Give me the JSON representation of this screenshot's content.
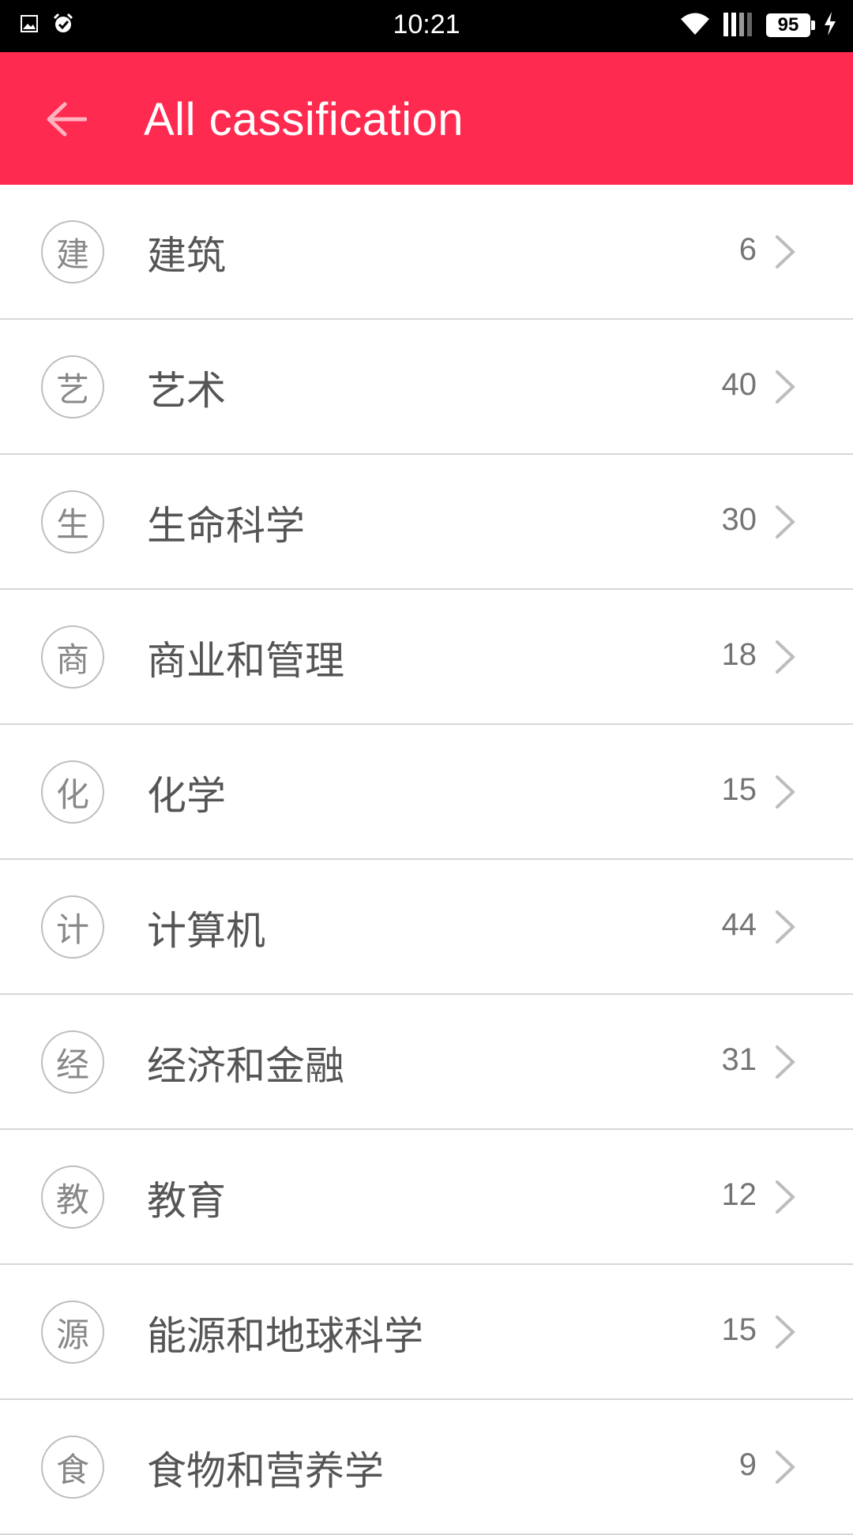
{
  "status_bar": {
    "time": "10:21",
    "battery": "95",
    "icons": [
      "image-icon",
      "alarm-icon",
      "wifi-icon",
      "signal-icon",
      "battery-icon",
      "charging-icon"
    ]
  },
  "app_bar": {
    "title": "All cassification",
    "background": "#ff2a50"
  },
  "categories": [
    {
      "badge": "建",
      "label": "建筑",
      "count": "6"
    },
    {
      "badge": "艺",
      "label": "艺术",
      "count": "40"
    },
    {
      "badge": "生",
      "label": "生命科学",
      "count": "30"
    },
    {
      "badge": "商",
      "label": "商业和管理",
      "count": "18"
    },
    {
      "badge": "化",
      "label": "化学",
      "count": "15"
    },
    {
      "badge": "计",
      "label": "计算机",
      "count": "44"
    },
    {
      "badge": "经",
      "label": "经济和金融",
      "count": "31"
    },
    {
      "badge": "教",
      "label": "教育",
      "count": "12"
    },
    {
      "badge": "源",
      "label": "能源和地球科学",
      "count": "15"
    },
    {
      "badge": "食",
      "label": "食物和营养学",
      "count": "9"
    }
  ]
}
